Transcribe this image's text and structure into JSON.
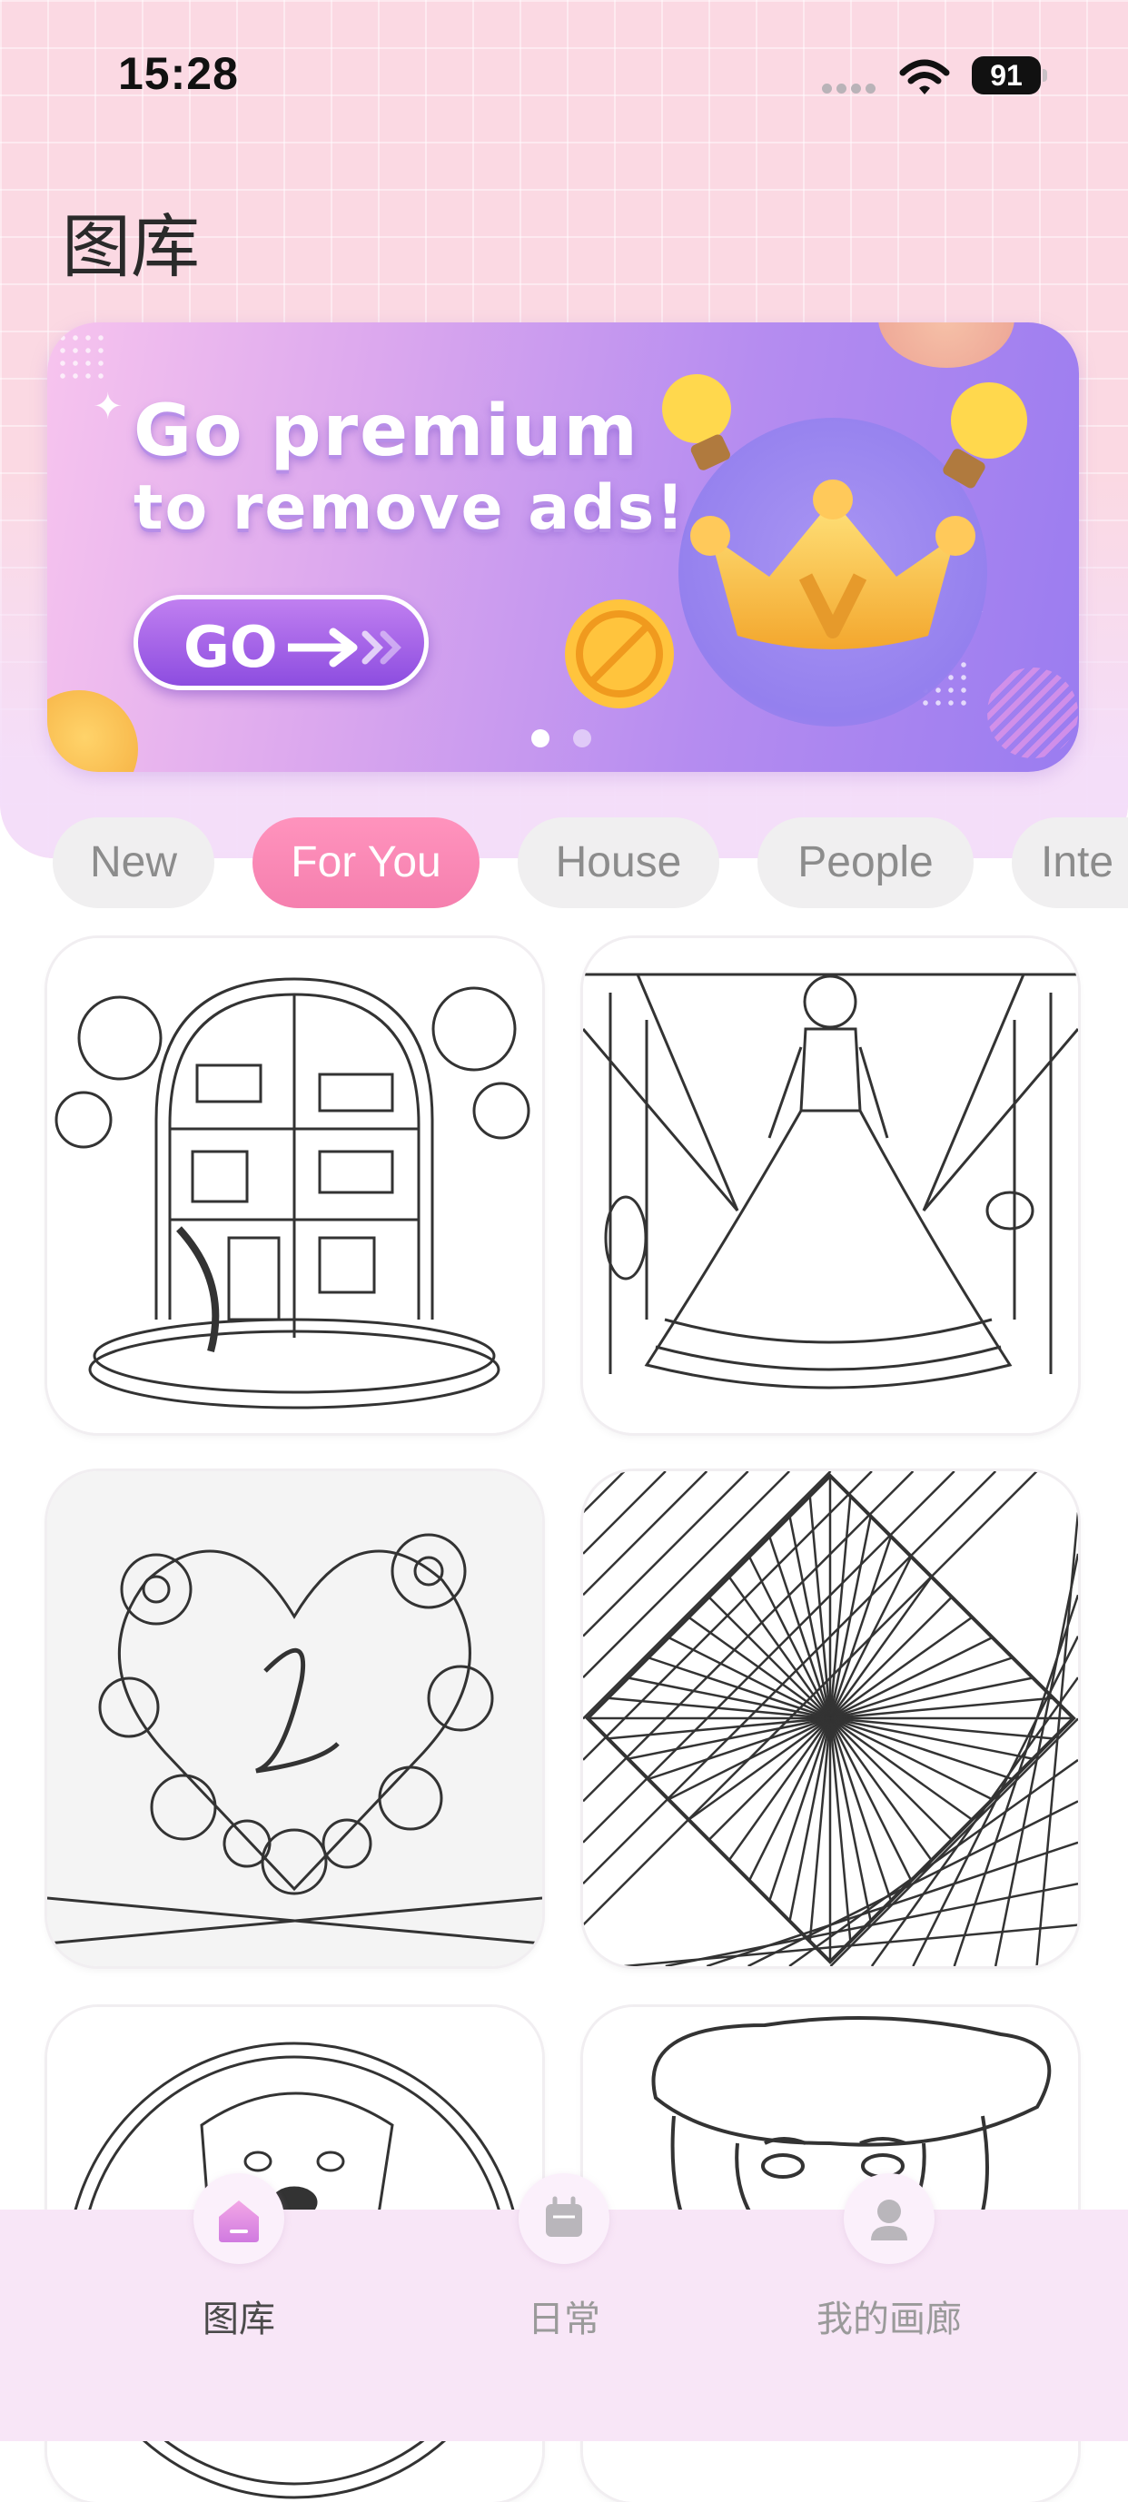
{
  "status_bar": {
    "time": "15:28",
    "battery": "91"
  },
  "page": {
    "title": "图库"
  },
  "banner": {
    "line1": "Go premium",
    "line2": "to remove ads!",
    "button_label": "GO",
    "page_indicator": {
      "count": 2,
      "active": 1
    }
  },
  "categories": [
    {
      "label": "New",
      "active": false
    },
    {
      "label": "For You",
      "active": true
    },
    {
      "label": "House",
      "active": false
    },
    {
      "label": "People",
      "active": false
    },
    {
      "label": "Inte",
      "active": false
    }
  ],
  "gallery": [
    {
      "subject": "dollhouse"
    },
    {
      "subject": "woman-in-ball-gown"
    },
    {
      "subject": "floral-heart-letter-l"
    },
    {
      "subject": "geometric-diamond"
    },
    {
      "subject": "dog-portrait"
    },
    {
      "subject": "woman-with-hat"
    }
  ],
  "tabbar": {
    "items": [
      {
        "label": "图库",
        "icon": "home-icon",
        "active": true
      },
      {
        "label": "日常",
        "icon": "calendar-icon",
        "active": false
      },
      {
        "label": "我的画廊",
        "icon": "profile-icon",
        "active": false
      }
    ]
  },
  "colors": {
    "accent_pink": "#f57fae",
    "banner_purple": "#9a7cf0",
    "tabbar_bg": "#f8e6f7"
  }
}
